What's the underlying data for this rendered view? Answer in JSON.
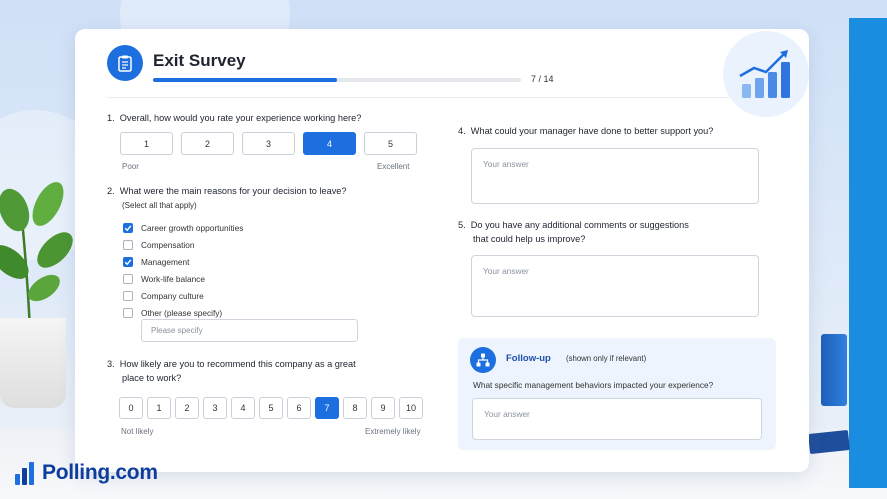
{
  "survey": {
    "title": "Exit Survey",
    "progress_text": "7 / 14",
    "progress_fraction": 0.5
  },
  "q1": {
    "number": "1.",
    "text": "Overall, how would you rate your experience working here?",
    "options": [
      "1",
      "2",
      "3",
      "4",
      "5"
    ],
    "selected": "4",
    "low_label": "Poor",
    "high_label": "Excellent"
  },
  "q2": {
    "number": "2.",
    "text": "What were the main reasons for your decision to leave?",
    "subtext": "(Select all that apply)",
    "options": [
      {
        "label": "Career growth opportunities",
        "checked": true
      },
      {
        "label": "Compensation",
        "checked": false
      },
      {
        "label": "Management",
        "checked": true
      },
      {
        "label": "Work-life balance",
        "checked": false
      },
      {
        "label": "Company culture",
        "checked": false
      },
      {
        "label": "Other (please specify)",
        "checked": false
      }
    ],
    "specify_placeholder": "Please specify"
  },
  "q3": {
    "number": "3.",
    "text_line1": "How likely are you to recommend this company as a great",
    "text_line2": "place to work?",
    "options": [
      "0",
      "1",
      "2",
      "3",
      "4",
      "5",
      "6",
      "7",
      "8",
      "9",
      "10"
    ],
    "selected": "7",
    "low_label": "Not likely",
    "high_label": "Extremely likely"
  },
  "q4": {
    "number": "4.",
    "text": "What could your manager have done to better support you?",
    "placeholder": "Your answer"
  },
  "q5": {
    "number": "5.",
    "text_line1": "Do you have any additional comments or suggestions",
    "text_line2": "that could help us improve?",
    "placeholder": "Your answer"
  },
  "followup": {
    "title": "Follow-up",
    "note": "(shown only if relevant)",
    "question": "What specific management behaviors impacted your experience?",
    "placeholder": "Your answer"
  },
  "brand": {
    "logo_text": "Polling.com"
  },
  "colors": {
    "accent": "#1d6fe0",
    "brand": "#0e3d9e",
    "panel": "#1a8de0"
  },
  "icons": {
    "header": "clipboard-icon",
    "badge": "growth-chart-icon",
    "followup": "hierarchy-icon",
    "check": "checkmark-icon",
    "logo": "bar-chart-logo-icon"
  }
}
